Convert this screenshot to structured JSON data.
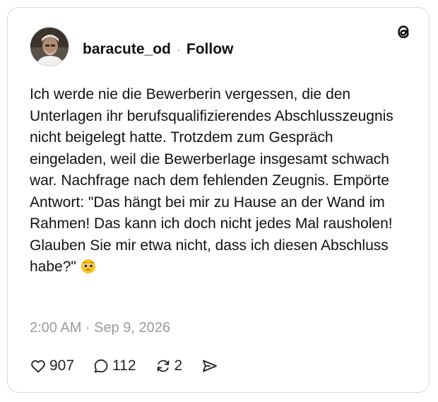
{
  "post": {
    "username": "baracute_od",
    "separator": "·",
    "follow_label": "Follow",
    "text": "Ich werde nie die Bewerberin vergessen, die den Unterlagen ihr berufsqualifizierendes Abschlusszeugnis nicht beigelegt hatte. Trotzdem zum Gespräch eingeladen, weil die Bewerberlage insgesamt schwach war. Nachfrage nach dem fehlenden Zeugnis. Empörte Antwort: \"Das hängt bei mir zu Hause an der Wand im Rahmen! Das kann ich doch nicht jedes Mal rausholen! Glauben Sie mir etwa nicht, dass ich diesen Abschluss habe?\"",
    "emoji_icon": "pleading-face-emoji",
    "timestamp": "2:00 AM · Sep 9, 2026"
  },
  "actions": {
    "likes": "907",
    "replies": "112",
    "reposts": "2"
  },
  "icons": {
    "logo": "threads-logo-icon",
    "like": "heart-icon",
    "reply": "speech-bubble-icon",
    "repost": "repost-icon",
    "share": "send-icon"
  },
  "colors": {
    "border": "#d9d9d9",
    "muted_text": "#9b9b9b",
    "text": "#111111"
  }
}
